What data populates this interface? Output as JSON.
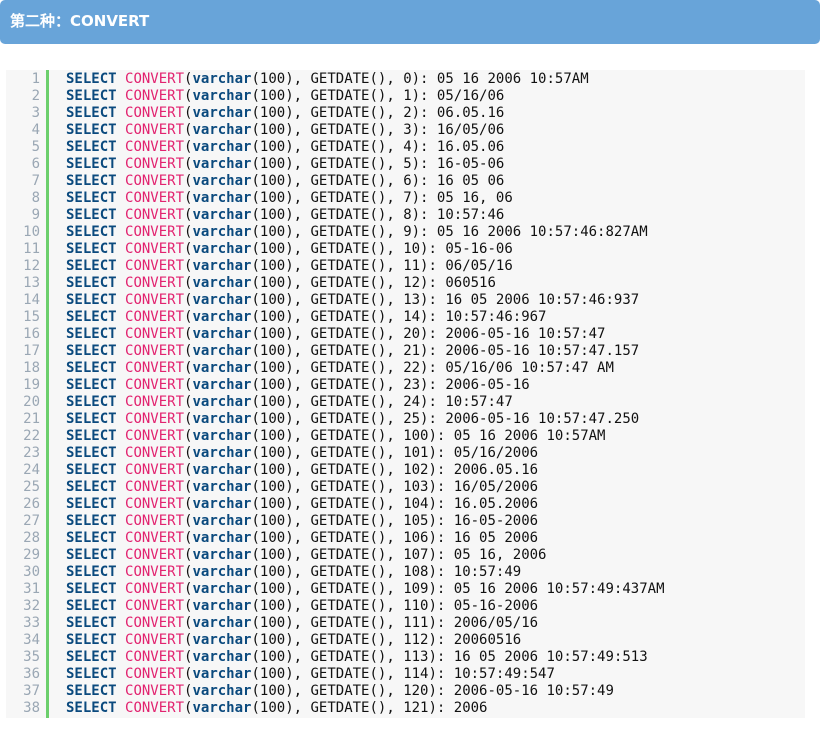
{
  "header": {
    "title": "第二种：CONVERT"
  },
  "code": {
    "lines": [
      {
        "num": "1",
        "kw": "SELECT",
        "fn": "CONVERT",
        "ty": "varchar",
        "rest": "(100), GETDATE(), 0): 05 16 2006 10:57AM"
      },
      {
        "num": "2",
        "kw": "SELECT",
        "fn": "CONVERT",
        "ty": "varchar",
        "rest": "(100), GETDATE(), 1): 05/16/06"
      },
      {
        "num": "3",
        "kw": "SELECT",
        "fn": "CONVERT",
        "ty": "varchar",
        "rest": "(100), GETDATE(), 2): 06.05.16"
      },
      {
        "num": "4",
        "kw": "SELECT",
        "fn": "CONVERT",
        "ty": "varchar",
        "rest": "(100), GETDATE(), 3): 16/05/06"
      },
      {
        "num": "5",
        "kw": "SELECT",
        "fn": "CONVERT",
        "ty": "varchar",
        "rest": "(100), GETDATE(), 4): 16.05.06"
      },
      {
        "num": "6",
        "kw": "SELECT",
        "fn": "CONVERT",
        "ty": "varchar",
        "rest": "(100), GETDATE(), 5): 16-05-06"
      },
      {
        "num": "7",
        "kw": "SELECT",
        "fn": "CONVERT",
        "ty": "varchar",
        "rest": "(100), GETDATE(), 6): 16 05 06"
      },
      {
        "num": "8",
        "kw": "SELECT",
        "fn": "CONVERT",
        "ty": "varchar",
        "rest": "(100), GETDATE(), 7): 05 16, 06"
      },
      {
        "num": "9",
        "kw": "SELECT",
        "fn": "CONVERT",
        "ty": "varchar",
        "rest": "(100), GETDATE(), 8): 10:57:46"
      },
      {
        "num": "10",
        "kw": "SELECT",
        "fn": "CONVERT",
        "ty": "varchar",
        "rest": "(100), GETDATE(), 9): 05 16 2006 10:57:46:827AM"
      },
      {
        "num": "11",
        "kw": "SELECT",
        "fn": "CONVERT",
        "ty": "varchar",
        "rest": "(100), GETDATE(), 10): 05-16-06"
      },
      {
        "num": "12",
        "kw": "SELECT",
        "fn": "CONVERT",
        "ty": "varchar",
        "rest": "(100), GETDATE(), 11): 06/05/16"
      },
      {
        "num": "13",
        "kw": "SELECT",
        "fn": "CONVERT",
        "ty": "varchar",
        "rest": "(100), GETDATE(), 12): 060516"
      },
      {
        "num": "14",
        "kw": "SELECT",
        "fn": "CONVERT",
        "ty": "varchar",
        "rest": "(100), GETDATE(), 13): 16 05 2006 10:57:46:937"
      },
      {
        "num": "15",
        "kw": "SELECT",
        "fn": "CONVERT",
        "ty": "varchar",
        "rest": "(100), GETDATE(), 14): 10:57:46:967"
      },
      {
        "num": "16",
        "kw": "SELECT",
        "fn": "CONVERT",
        "ty": "varchar",
        "rest": "(100), GETDATE(), 20): 2006-05-16 10:57:47"
      },
      {
        "num": "17",
        "kw": "SELECT",
        "fn": "CONVERT",
        "ty": "varchar",
        "rest": "(100), GETDATE(), 21): 2006-05-16 10:57:47.157"
      },
      {
        "num": "18",
        "kw": "SELECT",
        "fn": "CONVERT",
        "ty": "varchar",
        "rest": "(100), GETDATE(), 22): 05/16/06 10:57:47 AM"
      },
      {
        "num": "19",
        "kw": "SELECT",
        "fn": "CONVERT",
        "ty": "varchar",
        "rest": "(100), GETDATE(), 23): 2006-05-16"
      },
      {
        "num": "20",
        "kw": "SELECT",
        "fn": "CONVERT",
        "ty": "varchar",
        "rest": "(100), GETDATE(), 24): 10:57:47"
      },
      {
        "num": "21",
        "kw": "SELECT",
        "fn": "CONVERT",
        "ty": "varchar",
        "rest": "(100), GETDATE(), 25): 2006-05-16 10:57:47.250"
      },
      {
        "num": "22",
        "kw": "SELECT",
        "fn": "CONVERT",
        "ty": "varchar",
        "rest": "(100), GETDATE(), 100): 05 16 2006 10:57AM"
      },
      {
        "num": "23",
        "kw": "SELECT",
        "fn": "CONVERT",
        "ty": "varchar",
        "rest": "(100), GETDATE(), 101): 05/16/2006"
      },
      {
        "num": "24",
        "kw": "SELECT",
        "fn": "CONVERT",
        "ty": "varchar",
        "rest": "(100), GETDATE(), 102): 2006.05.16"
      },
      {
        "num": "25",
        "kw": "SELECT",
        "fn": "CONVERT",
        "ty": "varchar",
        "rest": "(100), GETDATE(), 103): 16/05/2006"
      },
      {
        "num": "26",
        "kw": "SELECT",
        "fn": "CONVERT",
        "ty": "varchar",
        "rest": "(100), GETDATE(), 104): 16.05.2006"
      },
      {
        "num": "27",
        "kw": "SELECT",
        "fn": "CONVERT",
        "ty": "varchar",
        "rest": "(100), GETDATE(), 105): 16-05-2006"
      },
      {
        "num": "28",
        "kw": "SELECT",
        "fn": "CONVERT",
        "ty": "varchar",
        "rest": "(100), GETDATE(), 106): 16 05 2006"
      },
      {
        "num": "29",
        "kw": "SELECT",
        "fn": "CONVERT",
        "ty": "varchar",
        "rest": "(100), GETDATE(), 107): 05 16, 2006"
      },
      {
        "num": "30",
        "kw": "SELECT",
        "fn": "CONVERT",
        "ty": "varchar",
        "rest": "(100), GETDATE(), 108): 10:57:49"
      },
      {
        "num": "31",
        "kw": "SELECT",
        "fn": "CONVERT",
        "ty": "varchar",
        "rest": "(100), GETDATE(), 109): 05 16 2006 10:57:49:437AM"
      },
      {
        "num": "32",
        "kw": "SELECT",
        "fn": "CONVERT",
        "ty": "varchar",
        "rest": "(100), GETDATE(), 110): 05-16-2006"
      },
      {
        "num": "33",
        "kw": "SELECT",
        "fn": "CONVERT",
        "ty": "varchar",
        "rest": "(100), GETDATE(), 111): 2006/05/16"
      },
      {
        "num": "34",
        "kw": "SELECT",
        "fn": "CONVERT",
        "ty": "varchar",
        "rest": "(100), GETDATE(), 112): 20060516"
      },
      {
        "num": "35",
        "kw": "SELECT",
        "fn": "CONVERT",
        "ty": "varchar",
        "rest": "(100), GETDATE(), 113): 16 05 2006 10:57:49:513"
      },
      {
        "num": "36",
        "kw": "SELECT",
        "fn": "CONVERT",
        "ty": "varchar",
        "rest": "(100), GETDATE(), 114): 10:57:49:547"
      },
      {
        "num": "37",
        "kw": "SELECT",
        "fn": "CONVERT",
        "ty": "varchar",
        "rest": "(100), GETDATE(), 120): 2006-05-16 10:57:49"
      },
      {
        "num": "38",
        "kw": "SELECT",
        "fn": "CONVERT",
        "ty": "varchar",
        "rest": "(100), GETDATE(), 121): 2006"
      }
    ]
  },
  "colors": {
    "header_bg": "#68a4d9",
    "keyword": "#0b4a7e",
    "function": "#e2226f",
    "gutter_bar": "#6ccf6c",
    "line_number": "#9aa7b4",
    "code_bg": "#f7f7f7"
  }
}
